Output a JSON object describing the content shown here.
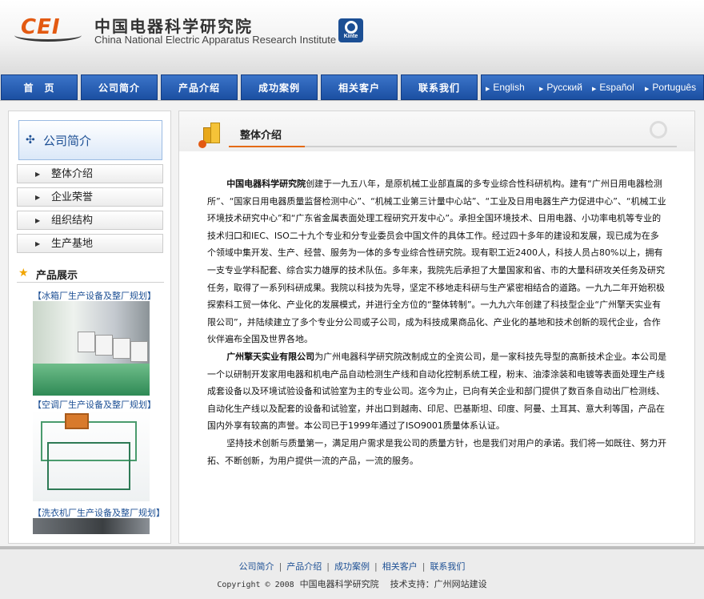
{
  "header": {
    "logo_text": "CEI",
    "org_cn": "中国电器科学研究院",
    "org_en": "China National Electric Apparatus Research Institute",
    "badge_text": "Kinte"
  },
  "nav": {
    "items": [
      "首　页",
      "公司简介",
      "产品介绍",
      "成功案例",
      "相关客户",
      "联系我们"
    ],
    "languages": [
      "English",
      "Русский",
      "Español",
      "Português"
    ]
  },
  "sidebar": {
    "title": "公司简介",
    "items": [
      "整体介绍",
      "企业荣誉",
      "组织结构",
      "生产基地"
    ],
    "products_heading": "产品展示",
    "product_captions": [
      "【冰箱厂生产设备及整厂规划】",
      "【空调厂生产设备及整厂规划】",
      "【洗衣机厂生产设备及整厂规划】"
    ]
  },
  "main": {
    "title": "整体介绍",
    "p1_bold": "中国电器科学研究院",
    "p1": "创建于一九五八年，是原机械工业部直属的多专业综合性科研机构。建有“广州日用电器检测所”、“国家日用电器质量监督检测中心”、“机械工业第三计量中心站”、“工业及日用电器生产力促进中心”、“机械工业环境技术研究中心”和“广东省金属表面处理工程研究开发中心”。承担全国环境技术、日用电器、小功率电机等专业的技术归口和IEC、ISO二十九个专业和分专业委员会中国文件的具体工作。经过四十多年的建设和发展，现已成为在多个领域中集开发、生产、经营、服务为一体的多专业综合性研究院。现有职工近2400人，科技人员占80%以上，拥有一支专业学科配套、综合实力雄厚的技术队伍。多年来，我院先后承担了大量国家和省、市的大量科研攻关任务及研究任务，取得了一系列科研成果。我院以科技为先导，坚定不移地走科研与生产紧密相结合的道路。一九九二年开始积极探索科工贸一体化、产业化的发展模式，并进行全方位的“整体转制”。一九九六年创建了科技型企业“广州擎天实业有限公司”，并陆续建立了多个专业分公司或子公司，成为科技成果商品化、产业化的基地和技术创新的现代企业，合作伙伴遍布全国及世界各地。",
    "p2_bold": "广州擎天实业有限公司",
    "p2": "为广州电器科学研究院改制成立的全资公司，是一家科技先导型的高新技术企业。本公司是一个以研制开发家用电器和机电产品自动检测生产线和自动化控制系统工程，粉末、油漆涂装和电镀等表面处理生产线成套设备以及环境试验设备和试验室为主的专业公司。迄今为止，已向有关企业和部门提供了数百条自动出厂检测线、自动化生产线以及配套的设备和试验室，并出口到越南、印尼、巴基斯坦、印度、阿曼、土耳其、意大利等国，产品在国内外享有较高的声誉。本公司已于1999年通过了ISO9001质量体系认证。",
    "p3": "坚持技术创新与质量第一，满足用户需求是我公司的质量方针，也是我们对用户的承诺。我们将一如既往、努力开拓、不断创新，为用户提供一流的产品，一流的服务。"
  },
  "footer": {
    "links": [
      "公司简介",
      "产品介绍",
      "成功案例",
      "相关客户",
      "联系我们"
    ],
    "copyright": "Copyright © 2008",
    "org": "中国电器科学研究院",
    "support": "技术支持：广州网站建设"
  },
  "colors": {
    "nav_blue": "#1b4fa2",
    "accent_orange": "#e46a12",
    "link_blue": "#1c4f94"
  }
}
